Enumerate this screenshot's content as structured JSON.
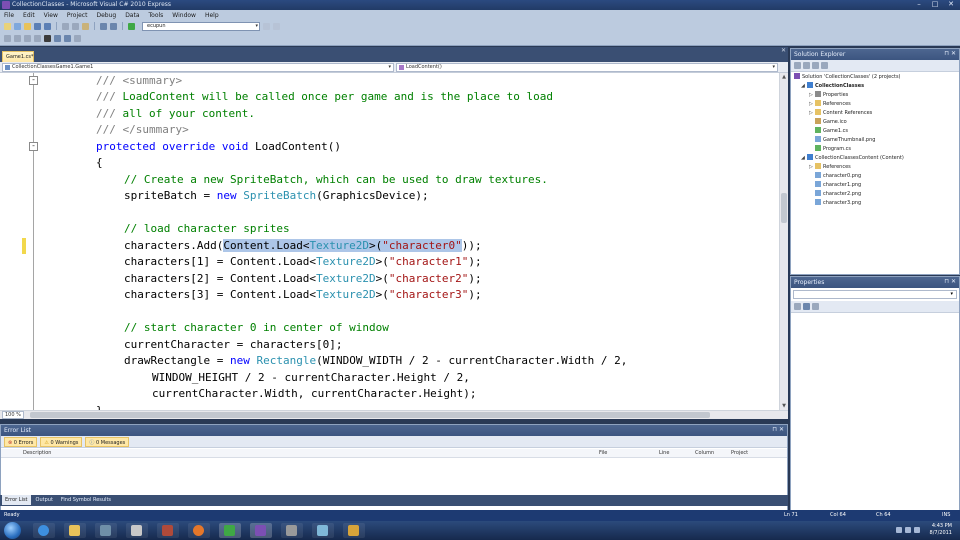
{
  "window": {
    "title": "CollectionClasses - Microsoft Visual C# 2010 Express"
  },
  "menu": [
    "File",
    "Edit",
    "View",
    "Project",
    "Debug",
    "Data",
    "Tools",
    "Window",
    "Help"
  ],
  "toolbar": {
    "config_combo": "ecupun"
  },
  "document": {
    "tab_label": "Game1.cs*",
    "nav_left": "CollectionClassesGame1.Game1",
    "nav_right": "LoadContent()",
    "zoom": "100 %",
    "code": {
      "l1_xml": "/// <summary>",
      "l2_xml_prefix": "/// ",
      "l2_text": "LoadContent will be called once per game and is the place to load",
      "l3_xml_prefix": "/// ",
      "l3_text": "all of your content.",
      "l4_xml": "/// </summary>",
      "l5_kw": "protected override void",
      "l5_rest": " LoadContent()",
      "l6": "{",
      "l7_comment": "// Create a new SpriteBatch, which can be used to draw textures.",
      "l8_a": "spriteBatch = ",
      "l8_kw": "new",
      "l8_sp": " ",
      "l8_type": "SpriteBatch",
      "l8_b": "(GraphicsDevice);",
      "l9_comment": "// load character sprites",
      "l10_a": "characters.Add(",
      "l10_sel_a": "Content.Load<",
      "l10_sel_type": "Texture2D",
      "l10_sel_b": ">(",
      "l10_sel_str": "\"character0\"",
      "l10_b": "));",
      "l11_a": "characters[1] = Content.Load<",
      "l11_type": "Texture2D",
      "l11_b": ">(",
      "l11_str": "\"character1\"",
      "l11_c": ");",
      "l12_a": "characters[2] = Content.Load<",
      "l12_type": "Texture2D",
      "l12_b": ">(",
      "l12_str": "\"character2\"",
      "l12_c": ");",
      "l13_a": "characters[3] = Content.Load<",
      "l13_type": "Texture2D",
      "l13_b": ">(",
      "l13_str": "\"character3\"",
      "l13_c": ");",
      "l14_comment": "// start character 0 in center of window",
      "l15": "currentCharacter = characters[0];",
      "l16_a": "drawRectangle = ",
      "l16_kw": "new",
      "l16_sp": " ",
      "l16_type": "Rectangle",
      "l16_b": "(WINDOW_WIDTH / 2 - currentCharacter.Width / 2,",
      "l17": "WINDOW_HEIGHT / 2 - currentCharacter.Height / 2,",
      "l18": "currentCharacter.Width, currentCharacter.Height);",
      "l19": "}"
    }
  },
  "solution_explorer": {
    "title": "Solution Explorer",
    "items": [
      "Solution 'CollectionClasses' (2 projects)",
      "CollectionClasses",
      "Properties",
      "References",
      "Content References",
      "Game.ico",
      "Game1.cs",
      "GameThumbnail.png",
      "Program.cs",
      "CollectionClassesContent (Content)",
      "References",
      "character0.png",
      "character1.png",
      "character2.png",
      "character3.png"
    ]
  },
  "properties": {
    "title": "Properties"
  },
  "error_list": {
    "title": "Error List",
    "errors": "0 Errors",
    "warnings": "0 Warnings",
    "messages": "0 Messages",
    "col_description": "Description",
    "col_file": "File",
    "col_line": "Line",
    "col_column": "Column",
    "col_project": "Project",
    "tabs": [
      "Error List",
      "Output",
      "Find Symbol Results"
    ]
  },
  "status": {
    "ready": "Ready",
    "ln": "Ln 71",
    "col": "Col 64",
    "ch": "Ch 64",
    "ins": "INS"
  },
  "clock": {
    "time": "4:43 PM",
    "date": "8/7/2011"
  },
  "colors": {
    "keyword": "#0000ff",
    "comment": "#008000",
    "type": "#2b91af",
    "string": "#a31515",
    "xmldoc": "#808080",
    "selection": "#adc6e8",
    "chrome": "#293955"
  }
}
